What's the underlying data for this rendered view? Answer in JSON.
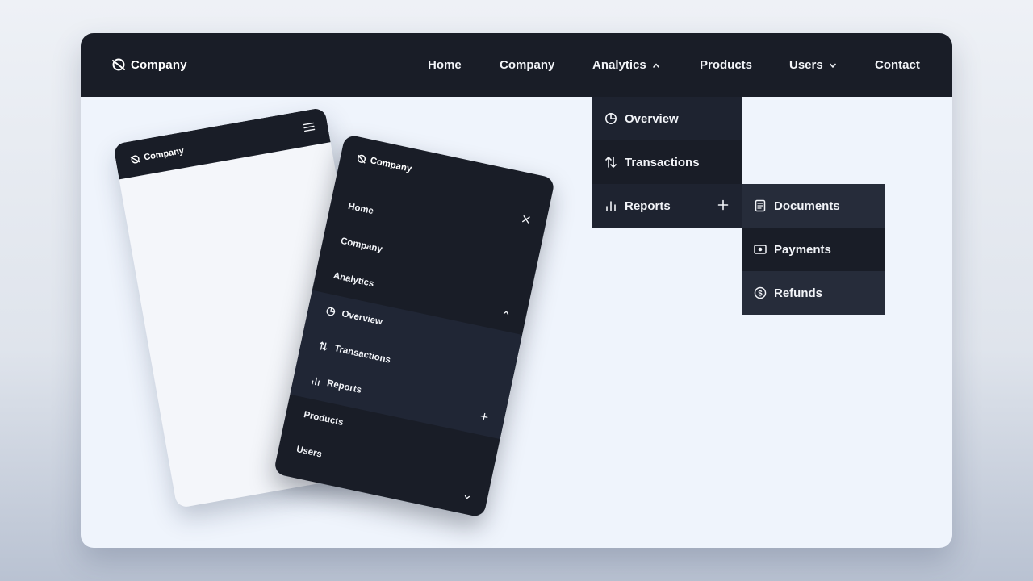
{
  "brand": {
    "name": "Company"
  },
  "nav": {
    "items": [
      {
        "label": "Home"
      },
      {
        "label": "Company"
      },
      {
        "label": "Analytics"
      },
      {
        "label": "Products"
      },
      {
        "label": "Users"
      },
      {
        "label": "Contact"
      }
    ]
  },
  "dropdown": {
    "items": [
      {
        "label": "Overview",
        "icon": "pie-chart-icon"
      },
      {
        "label": "Transactions",
        "icon": "arrows-updown-icon"
      },
      {
        "label": "Reports",
        "icon": "bar-chart-icon"
      }
    ]
  },
  "submenu": {
    "items": [
      {
        "label": "Documents",
        "icon": "document-icon"
      },
      {
        "label": "Payments",
        "icon": "cash-icon"
      },
      {
        "label": "Refunds",
        "icon": "dollar-circle-icon"
      }
    ]
  },
  "mobile": {
    "brand": "Company",
    "items": [
      {
        "label": "Home"
      },
      {
        "label": "Company"
      },
      {
        "label": "Analytics"
      },
      {
        "label": "Products"
      },
      {
        "label": "Users"
      }
    ],
    "analytics_sub": [
      {
        "label": "Overview"
      },
      {
        "label": "Transactions"
      },
      {
        "label": "Reports"
      }
    ]
  },
  "colors": {
    "nav_bg": "#191d27",
    "dropdown_bg": "#1e2330",
    "submenu_bg": "#262c3a",
    "page_bg": "#eff4fc",
    "text": "#f2f4f8"
  }
}
